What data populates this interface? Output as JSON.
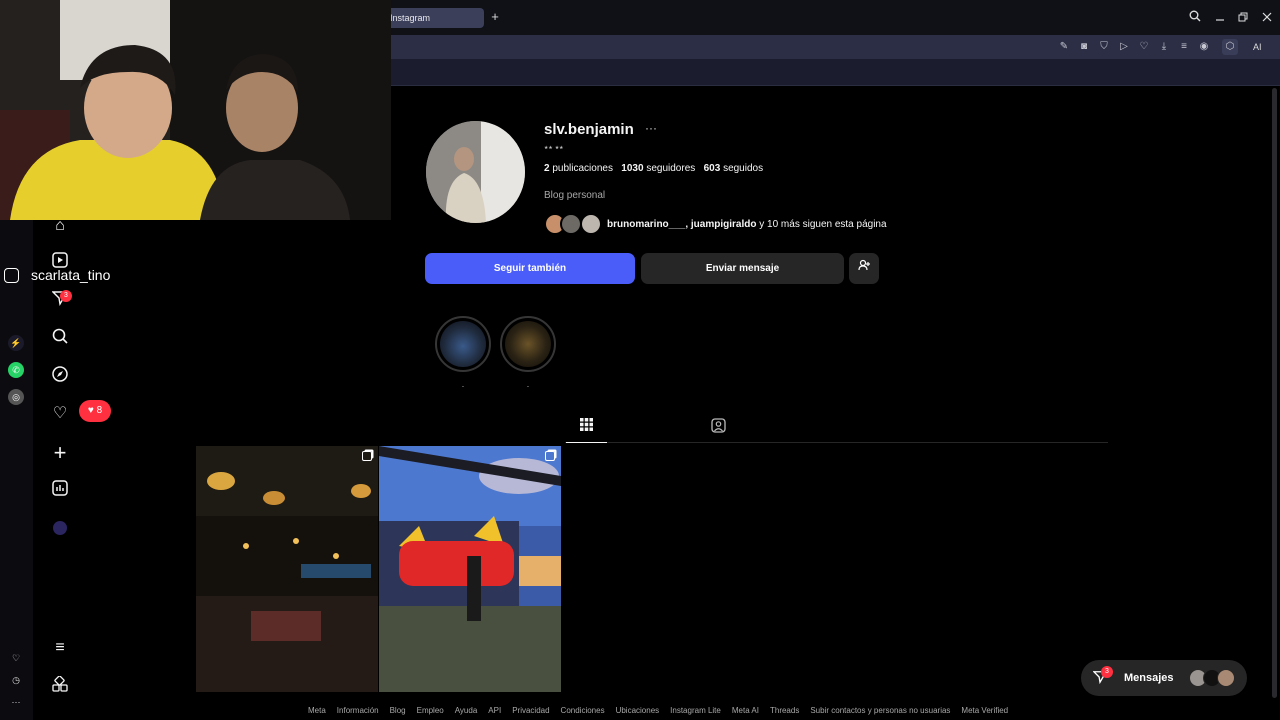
{
  "browser": {
    "tab_title": "Instagram",
    "new_tab_icon": "+",
    "ai_label": "AI"
  },
  "overlay": {
    "username": "scarlata_tino"
  },
  "nav": {
    "direct_badge": "3",
    "notifications_badge": "8"
  },
  "profile": {
    "username": "slv.benjamin",
    "options_icon": "···",
    "threads_handle": "⭑⭑ ⭑⭑",
    "posts_count": "2",
    "posts_label": "publicaciones",
    "followers_count": "1030",
    "followers_label": "seguidores",
    "following_count": "603",
    "following_label": "seguidos",
    "category": "Blog personal",
    "followed_by_names": "brunomarino___, juampigiraldo",
    "followed_by_rest": " y 10 más siguen esta página",
    "follow_back_label": "Seguir también",
    "message_label": "Enviar mensaje",
    "highlights": [
      ".",
      "."
    ]
  },
  "footer": {
    "links": [
      "Meta",
      "Información",
      "Blog",
      "Empleo",
      "Ayuda",
      "API",
      "Privacidad",
      "Condiciones",
      "Ubicaciones",
      "Instagram Lite",
      "Meta AI",
      "Threads",
      "Subir contactos y personas no usuarias",
      "Meta Verified"
    ]
  },
  "messages": {
    "label": "Mensajes",
    "badge": "3"
  },
  "colors": {
    "follow_button": "#4a5df9",
    "badge": "#ff3040",
    "background": "#000000"
  }
}
